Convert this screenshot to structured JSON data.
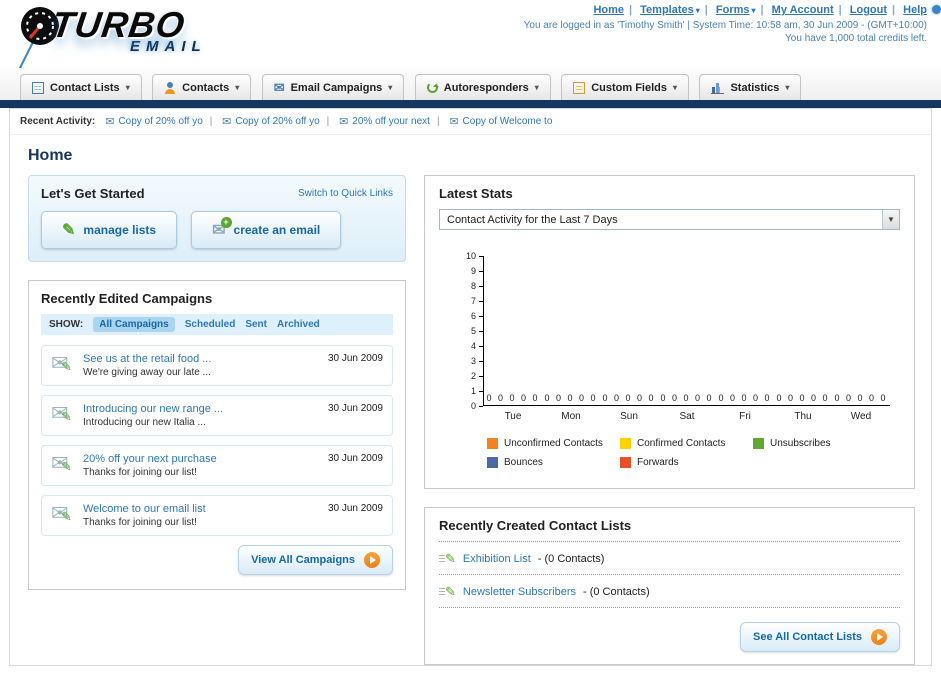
{
  "header": {
    "logo": {
      "line1": "TURBO",
      "line2": "EMAIL"
    },
    "top_links": [
      {
        "label": "Home"
      },
      {
        "label": "Templates",
        "dropdown": true
      },
      {
        "label": "Forms",
        "dropdown": true
      },
      {
        "label": "My Account"
      },
      {
        "label": "Logout"
      },
      {
        "label": "Help"
      }
    ],
    "login_info": "You are logged in as 'Timothy Smith' | System Time: 10:58 am, 30 Jun 2009 - (GMT+10:00)",
    "credits_info": "You have 1,000 total credits left."
  },
  "nav_tabs": [
    {
      "label": "Contact Lists"
    },
    {
      "label": "Contacts"
    },
    {
      "label": "Email Campaigns"
    },
    {
      "label": "Autoresponders"
    },
    {
      "label": "Custom Fields"
    },
    {
      "label": "Statistics"
    }
  ],
  "recent_activity": {
    "label": "Recent Activity:",
    "items": [
      {
        "label": "Copy of 20% off yo"
      },
      {
        "label": "Copy of 20% off yo"
      },
      {
        "label": "20% off your next"
      },
      {
        "label": "Copy of Welcome to"
      }
    ]
  },
  "page_title": "Home",
  "get_started": {
    "title": "Let's Get Started",
    "switch_link": "Switch to Quick Links",
    "manage_lists_label": "manage lists",
    "create_email_label": "create an email"
  },
  "campaigns": {
    "title": "Recently Edited Campaigns",
    "show_label": "SHOW:",
    "filters": [
      {
        "label": "All Campaigns",
        "active": true
      },
      {
        "label": "Scheduled"
      },
      {
        "label": "Sent"
      },
      {
        "label": "Archived"
      }
    ],
    "items": [
      {
        "title": "See us at the retail food ...",
        "subtitle": "We're giving away our late ...",
        "date": "30 Jun 2009"
      },
      {
        "title": "Introducing our new range ...",
        "subtitle": "Introducing our new Italia ...",
        "date": "30 Jun 2009"
      },
      {
        "title": "20% off your next purchase",
        "subtitle": "Thanks for joining our list!",
        "date": "30 Jun 2009"
      },
      {
        "title": "Welcome to our email list",
        "subtitle": "Thanks for joining our list!",
        "date": "30 Jun 2009"
      }
    ],
    "view_all_label": "View All Campaigns"
  },
  "latest_stats": {
    "title": "Latest Stats",
    "dropdown_value": "Contact Activity for the Last 7 Days"
  },
  "chart_data": {
    "type": "bar",
    "title": "Contact Activity for the Last 7 Days",
    "categories": [
      "Tue",
      "Mon",
      "Sun",
      "Sat",
      "Fri",
      "Thu",
      "Wed"
    ],
    "series": [
      {
        "name": "Unconfirmed Contacts",
        "color": "#f58220",
        "values": [
          0,
          0,
          0,
          0,
          0,
          0,
          0
        ]
      },
      {
        "name": "Confirmed Contacts",
        "color": "#ffd200",
        "values": [
          0,
          0,
          0,
          0,
          0,
          0,
          0
        ]
      },
      {
        "name": "Unsubscribes",
        "color": "#61a832",
        "values": [
          0,
          0,
          0,
          0,
          0,
          0,
          0
        ]
      },
      {
        "name": "Bounces",
        "color": "#4a69a5",
        "values": [
          0,
          0,
          0,
          0,
          0,
          0,
          0
        ]
      },
      {
        "name": "Forwards",
        "color": "#e8502a",
        "values": [
          0,
          0,
          0,
          0,
          0,
          0,
          0
        ]
      }
    ],
    "ylim": [
      0,
      10
    ],
    "ytick_step": 1,
    "grid": false,
    "legend_position": "bottom"
  },
  "contact_lists": {
    "title": "Recently Created Contact Lists",
    "items": [
      {
        "name": "Exhibition List",
        "suffix": "- (0 Contacts)"
      },
      {
        "name": "Newsletter Subscribers",
        "suffix": "- (0 Contacts)"
      }
    ],
    "see_all_label": "See All Contact Lists"
  }
}
